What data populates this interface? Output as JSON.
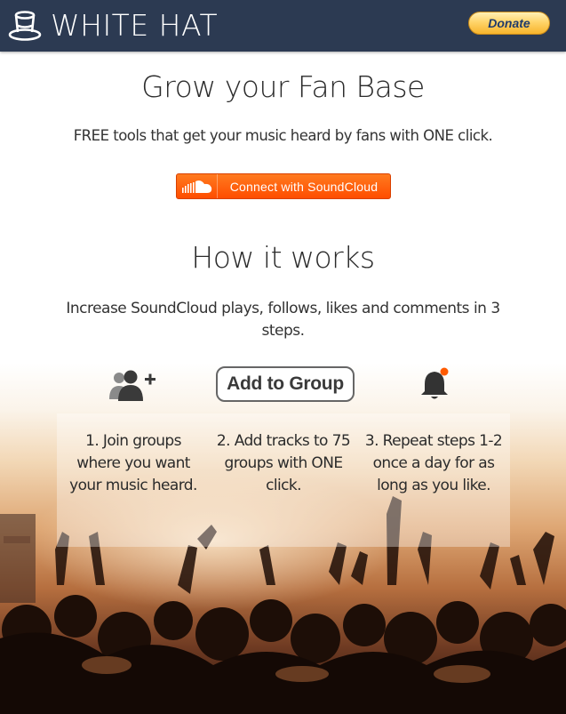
{
  "header": {
    "brand": "WHITE HAT",
    "donate_label": "Donate",
    "background_color": "#2c3a52"
  },
  "hero": {
    "title": "Grow your Fan Base",
    "tagline": "FREE tools that get your music heard by fans with ONE click.",
    "connect_button": {
      "label": "Connect with SoundCloud",
      "icon": "soundcloud-icon",
      "color": "#ff5500"
    }
  },
  "how_it_works": {
    "title": "How it works",
    "subtitle": "Increase SoundCloud plays, follows, likes and comments in 3 steps.",
    "add_to_group_label": "Add to Group",
    "steps": [
      {
        "icon": "add-user-icon",
        "text": "1. Join groups where you want your music heard."
      },
      {
        "icon": "add-to-group-badge",
        "text": "2. Add tracks to 75 groups with ONE click."
      },
      {
        "icon": "bell-notification-icon",
        "text": "3. Repeat steps 1-2 once a day for as long as you like."
      }
    ]
  }
}
